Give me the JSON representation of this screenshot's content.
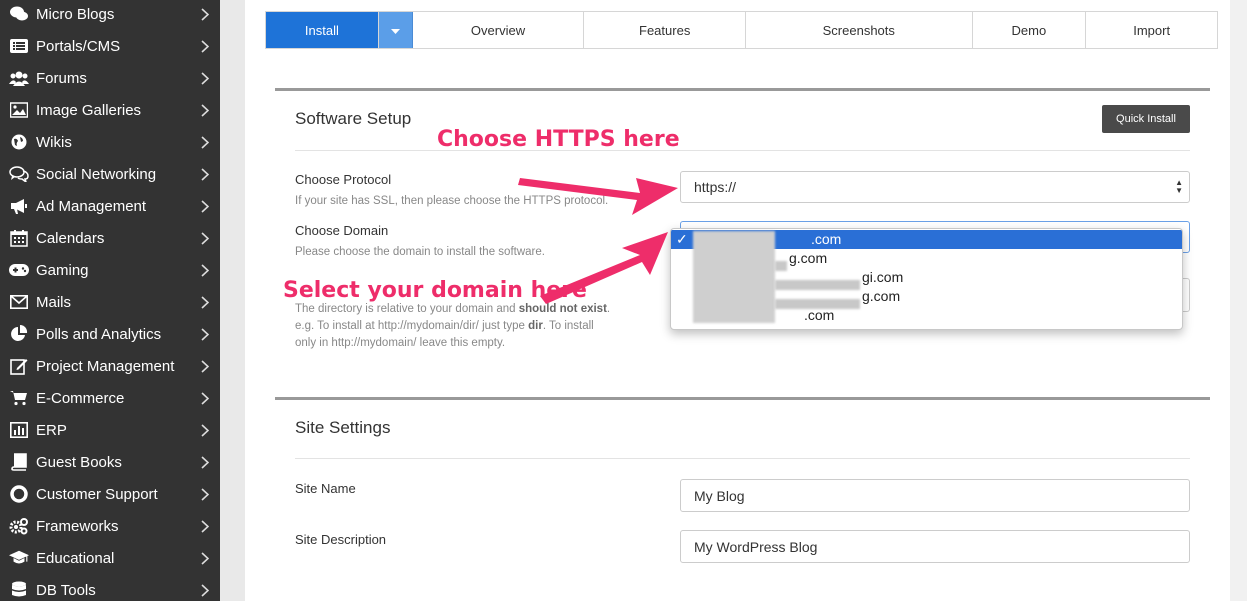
{
  "sidebar": {
    "items": [
      {
        "label": "Micro Blogs",
        "icon": "chat-bubbles-icon"
      },
      {
        "label": "Portals/CMS",
        "icon": "list-icon"
      },
      {
        "label": "Forums",
        "icon": "users-icon"
      },
      {
        "label": "Image Galleries",
        "icon": "image-icon"
      },
      {
        "label": "Wikis",
        "icon": "globe-icon"
      },
      {
        "label": "Social Networking",
        "icon": "comments-icon"
      },
      {
        "label": "Ad Management",
        "icon": "megaphone-icon"
      },
      {
        "label": "Calendars",
        "icon": "calendar-icon"
      },
      {
        "label": "Gaming",
        "icon": "gamepad-icon"
      },
      {
        "label": "Mails",
        "icon": "envelope-icon"
      },
      {
        "label": "Polls and Analytics",
        "icon": "pie-chart-icon"
      },
      {
        "label": "Project Management",
        "icon": "edit-icon"
      },
      {
        "label": "E-Commerce",
        "icon": "cart-icon"
      },
      {
        "label": "ERP",
        "icon": "bar-chart-icon"
      },
      {
        "label": "Guest Books",
        "icon": "book-icon"
      },
      {
        "label": "Customer Support",
        "icon": "lifebuoy-icon"
      },
      {
        "label": "Frameworks",
        "icon": "cogs-icon"
      },
      {
        "label": "Educational",
        "icon": "graduation-cap-icon"
      },
      {
        "label": "DB Tools",
        "icon": "database-icon"
      }
    ]
  },
  "tabs": {
    "install": "Install",
    "overview": "Overview",
    "features": "Features",
    "screenshots": "Screenshots",
    "demo": "Demo",
    "import": "Import"
  },
  "software_setup": {
    "title": "Software Setup",
    "quick_install": "Quick Install",
    "protocol_label": "Choose Protocol",
    "protocol_help": "If your site has SSL, then please choose the HTTPS protocol.",
    "protocol_value": "https://",
    "domain_label": "Choose Domain",
    "domain_help": "Please choose the domain to install the software.",
    "directory_help_1": "The directory is relative to your domain and",
    "directory_help_bold": "should not exist",
    "directory_help_2": "e.g. To install at http://mydomain/dir/ just type",
    "directory_help_dir": "dir",
    "directory_help_3": "To install",
    "directory_help_4": "only in http://mydomain/ leave this empty."
  },
  "domain_dropdown": {
    "options": [
      ".com",
      "g.com",
      "gi.com",
      "g.com",
      ".com"
    ],
    "selected_index": 0
  },
  "annotations": {
    "https": "Choose HTTPS here",
    "domain": "Select your domain here",
    "color": "#ee2d6a"
  },
  "site_settings": {
    "title": "Site Settings",
    "site_name_label": "Site Name",
    "site_name_value": "My Blog",
    "site_desc_label": "Site Description",
    "site_desc_value": "My WordPress Blog"
  }
}
